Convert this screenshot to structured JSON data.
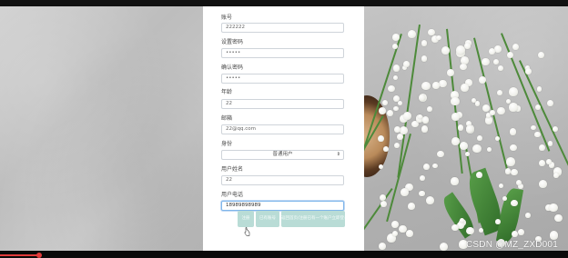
{
  "form": {
    "account_label": "账号",
    "account_value": "222222",
    "password_label": "设置密码",
    "password_value": "•••••",
    "confirm_label": "确认密码",
    "confirm_value": "•••••",
    "age_label": "年龄",
    "age_value": "22",
    "email_label": "邮箱",
    "email_value": "22@qq.com",
    "role_label": "身份",
    "role_value": "普通用户",
    "username_label": "用户姓名",
    "username_value": "22",
    "phone_label": "用户电话",
    "phone_value": "18989898989"
  },
  "buttons": {
    "submit": "注册",
    "cancel": "已有账号",
    "back": "返回首页/注册已有一个账户立即登录"
  },
  "watermark": "CSDN @MZ_ZXD001",
  "colors": {
    "button": "#b9dcd6",
    "focus_border": "#7fb6ea",
    "panel": "#ffffff"
  },
  "icons": [
    "select-caret-icon",
    "mouse-cursor-icon",
    "record-indicator-icon"
  ]
}
